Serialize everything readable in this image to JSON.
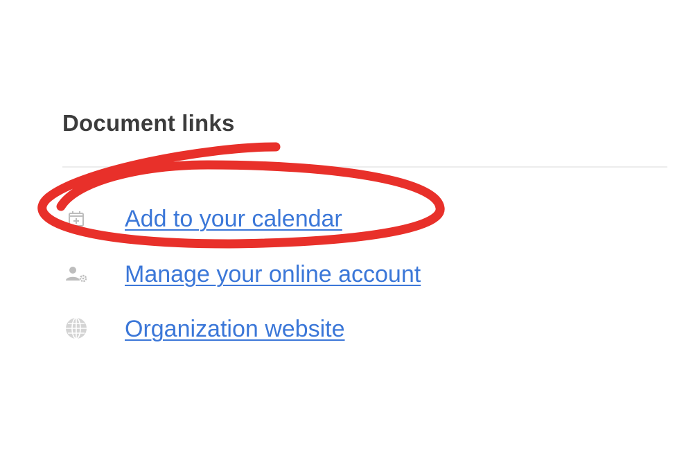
{
  "section": {
    "title": "Document links"
  },
  "links": [
    {
      "label": "Add to your calendar",
      "icon": "calendar-add-icon"
    },
    {
      "label": "Manage your online account",
      "icon": "user-settings-icon"
    },
    {
      "label": "Organization website",
      "icon": "globe-icon"
    }
  ],
  "colors": {
    "link": "#3b77d8",
    "title": "#3c3c3c",
    "icon": "#bdbdbd",
    "annotation": "#e8302a"
  },
  "annotation": {
    "type": "hand-drawn-ellipse",
    "target": "Add to your calendar"
  }
}
